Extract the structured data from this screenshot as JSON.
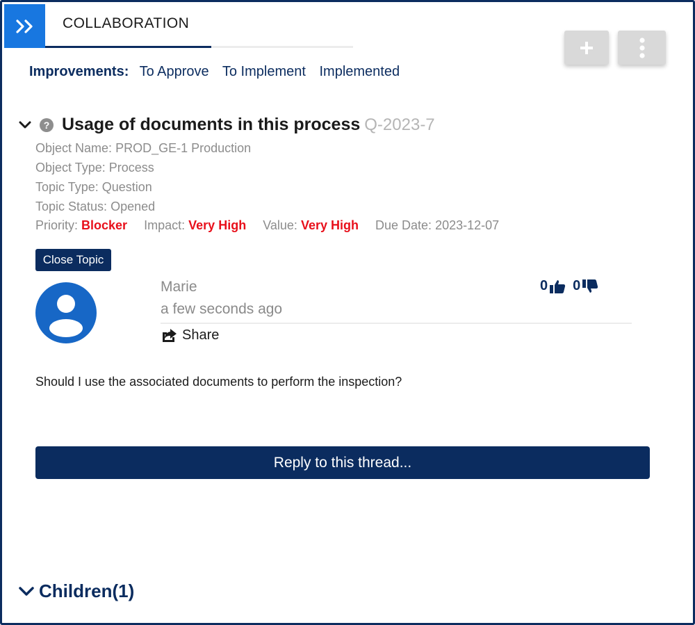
{
  "panel": {
    "title": "COLLABORATION"
  },
  "improvements": {
    "label": "Improvements:",
    "links": [
      "To Approve",
      "To Implement",
      "Implemented"
    ]
  },
  "topic": {
    "title": "Usage of documents in this process",
    "id": "Q-2023-7",
    "object_name_label": "Object Name:",
    "object_name": "PROD_GE-1 Production",
    "object_type_label": "Object Type:",
    "object_type": "Process",
    "topic_type_label": "Topic Type:",
    "topic_type": "Question",
    "topic_status_label": "Topic Status:",
    "topic_status": "Opened",
    "priority_label": "Priority:",
    "priority": "Blocker",
    "impact_label": "Impact:",
    "impact": "Very High",
    "value_label": "Value:",
    "value": "Very High",
    "due_date_label": "Due Date:",
    "due_date": "2023-12-07",
    "close_label": "Close Topic"
  },
  "post": {
    "author": "Marie",
    "time": "a few seconds ago",
    "share_label": "Share",
    "likes": "0",
    "dislikes": "0",
    "message": "Should I use the associated documents to perform the inspection?"
  },
  "reply": {
    "label": "Reply to this thread..."
  },
  "children": {
    "label": "Children(1)"
  },
  "colors": {
    "navy": "#0b2c5f",
    "accent_blue": "#1877e0",
    "avatar_blue": "#1767c6",
    "alert_red": "#e8101b"
  },
  "icons": [
    "double-chevron-right-icon",
    "plus-icon",
    "kebab-menu-icon",
    "chevron-down-icon",
    "question-circle-icon",
    "user-icon",
    "share-icon",
    "thumbs-up-icon",
    "thumbs-down-icon"
  ]
}
